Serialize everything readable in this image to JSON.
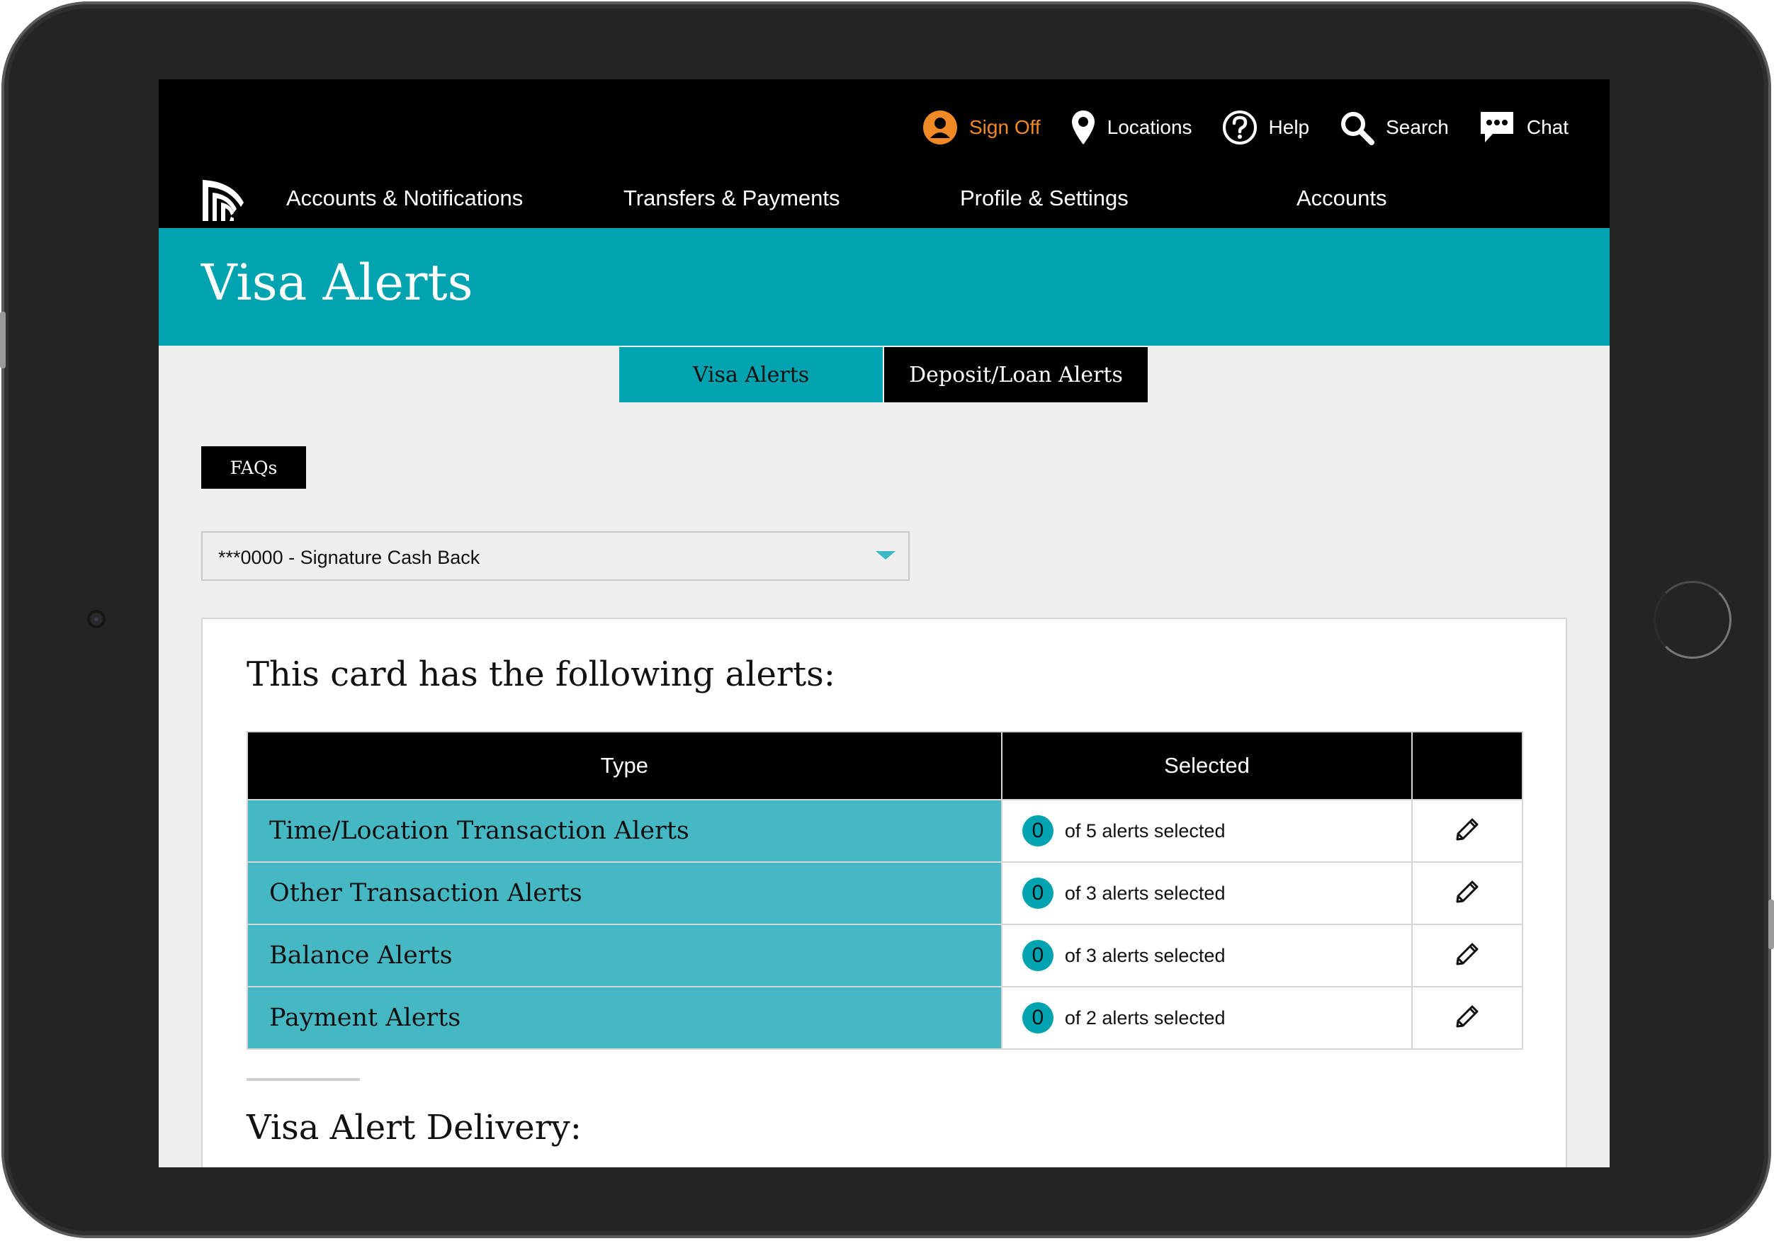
{
  "header": {
    "utility": [
      {
        "label": "Sign Off",
        "icon": "user-icon"
      },
      {
        "label": "Locations",
        "icon": "map-pin-icon"
      },
      {
        "label": "Help",
        "icon": "help-icon"
      },
      {
        "label": "Search",
        "icon": "search-icon"
      },
      {
        "label": "Chat",
        "icon": "chat-icon"
      }
    ],
    "nav": [
      "Accounts & Notifications",
      "Transfers & Payments",
      "Profile & Settings",
      "Accounts"
    ]
  },
  "banner": {
    "title": "Visa Alerts"
  },
  "tabs": [
    {
      "label": "Visa Alerts",
      "active": true
    },
    {
      "label": "Deposit/Loan Alerts",
      "active": false
    }
  ],
  "faq_label": "FAQs",
  "card_select": {
    "value": "***0000 - Signature Cash Back"
  },
  "alerts_card": {
    "heading": "This card has the following alerts:",
    "columns": [
      "Type",
      "Selected",
      ""
    ],
    "rows": [
      {
        "type": "Time/Location Transaction Alerts",
        "count": "0",
        "text": "of 5 alerts selected"
      },
      {
        "type": "Other Transaction Alerts",
        "count": "0",
        "text": "of 3 alerts selected"
      },
      {
        "type": "Balance Alerts",
        "count": "0",
        "text": "of 3 alerts selected"
      },
      {
        "type": "Payment Alerts",
        "count": "0",
        "text": "of 2 alerts selected"
      }
    ],
    "delivery_heading": "Visa Alert Delivery:"
  },
  "colors": {
    "teal": "#02a3b0",
    "teal_light": "#46b8c4",
    "accent_orange": "#f08a24",
    "black": "#000000"
  }
}
